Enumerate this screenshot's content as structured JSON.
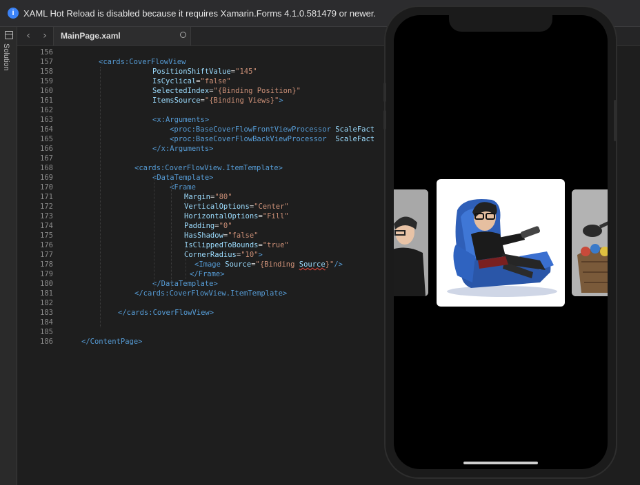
{
  "infobar": {
    "icon": "info-icon",
    "message": "XAML Hot Reload is disabled because it requires Xamarin.Forms 4.1.0.581479 or newer."
  },
  "sidebar": {
    "label": "Solution",
    "icon": "solution-panel-icon"
  },
  "editor": {
    "nav_back": "‹",
    "nav_forward": "›",
    "tab": {
      "label": "MainPage.xaml"
    },
    "lines": [
      {
        "n": "156",
        "indent": 0,
        "parts": []
      },
      {
        "n": "157",
        "indent": 1,
        "parts": [
          {
            "c": "tag",
            "t": "<cards:CoverFlowView"
          }
        ]
      },
      {
        "n": "158",
        "indent": 2,
        "parts": [
          {
            "c": "attr",
            "t": "PositionShiftValue"
          },
          {
            "c": "txt",
            "t": "="
          },
          {
            "c": "str",
            "t": "\"145\""
          }
        ]
      },
      {
        "n": "159",
        "indent": 2,
        "parts": [
          {
            "c": "attr",
            "t": "IsCyclical"
          },
          {
            "c": "txt",
            "t": "="
          },
          {
            "c": "str",
            "t": "\"false\""
          }
        ]
      },
      {
        "n": "160",
        "indent": 2,
        "parts": [
          {
            "c": "attr",
            "t": "SelectedIndex"
          },
          {
            "c": "txt",
            "t": "="
          },
          {
            "c": "str",
            "t": "\"{Binding Position}\""
          }
        ]
      },
      {
        "n": "161",
        "indent": 2,
        "parts": [
          {
            "c": "attr",
            "t": "ItemsSource"
          },
          {
            "c": "txt",
            "t": "="
          },
          {
            "c": "str",
            "t": "\"{Binding Views}\""
          },
          {
            "c": "tag",
            "t": ">"
          }
        ]
      },
      {
        "n": "162",
        "indent": 0,
        "parts": []
      },
      {
        "n": "163",
        "indent": 2,
        "parts": [
          {
            "c": "tag",
            "t": "<x:Arguments>"
          }
        ]
      },
      {
        "n": "164",
        "indent": 3,
        "parts": [
          {
            "c": "tag",
            "t": "<proc:BaseCoverFlowFrontViewProcessor "
          },
          {
            "c": "attr",
            "t": "ScaleFact"
          }
        ]
      },
      {
        "n": "165",
        "indent": 3,
        "parts": [
          {
            "c": "tag",
            "t": "<proc:BaseCoverFlowBackViewProcessor  "
          },
          {
            "c": "attr",
            "t": "ScaleFact"
          }
        ]
      },
      {
        "n": "166",
        "indent": 2,
        "parts": [
          {
            "c": "tag",
            "t": "</x:Arguments>"
          }
        ]
      },
      {
        "n": "167",
        "indent": 0,
        "parts": []
      },
      {
        "n": "168",
        "indent": 4,
        "parts": [
          {
            "c": "tag",
            "t": "<cards:CoverFlowView.ItemTemplate>"
          }
        ]
      },
      {
        "n": "169",
        "indent": 5,
        "parts": [
          {
            "c": "tag",
            "t": "<DataTemplate>"
          }
        ]
      },
      {
        "n": "170",
        "indent": 6,
        "parts": [
          {
            "c": "tag",
            "t": "<Frame"
          }
        ]
      },
      {
        "n": "171",
        "indent": 7,
        "parts": [
          {
            "c": "attr",
            "t": "Margin"
          },
          {
            "c": "txt",
            "t": "="
          },
          {
            "c": "str",
            "t": "\"80\""
          }
        ]
      },
      {
        "n": "172",
        "indent": 7,
        "parts": [
          {
            "c": "attr",
            "t": "VerticalOptions"
          },
          {
            "c": "txt",
            "t": "="
          },
          {
            "c": "str",
            "t": "\"Center\""
          }
        ]
      },
      {
        "n": "173",
        "indent": 7,
        "parts": [
          {
            "c": "attr",
            "t": "HorizontalOptions"
          },
          {
            "c": "txt",
            "t": "="
          },
          {
            "c": "str",
            "t": "\"Fill\""
          }
        ]
      },
      {
        "n": "174",
        "indent": 7,
        "parts": [
          {
            "c": "attr",
            "t": "Padding"
          },
          {
            "c": "txt",
            "t": "="
          },
          {
            "c": "str",
            "t": "\"0\""
          }
        ]
      },
      {
        "n": "175",
        "indent": 7,
        "parts": [
          {
            "c": "attr",
            "t": "HasShadow"
          },
          {
            "c": "txt",
            "t": "="
          },
          {
            "c": "str",
            "t": "\"false\""
          }
        ]
      },
      {
        "n": "176",
        "indent": 7,
        "parts": [
          {
            "c": "attr",
            "t": "IsClippedToBounds"
          },
          {
            "c": "txt",
            "t": "="
          },
          {
            "c": "str",
            "t": "\"true\""
          }
        ]
      },
      {
        "n": "177",
        "indent": 7,
        "parts": [
          {
            "c": "attr",
            "t": "CornerRadius"
          },
          {
            "c": "txt",
            "t": "="
          },
          {
            "c": "str",
            "t": "\"10\""
          },
          {
            "c": "tag",
            "t": ">"
          }
        ]
      },
      {
        "n": "178",
        "indent": 8,
        "parts": [
          {
            "c": "tag",
            "t": "<Image "
          },
          {
            "c": "attr",
            "t": "Source"
          },
          {
            "c": "txt",
            "t": "="
          },
          {
            "c": "str",
            "t": "\"{Binding "
          },
          {
            "c": "attr squig",
            "t": "Source"
          },
          {
            "c": "str",
            "t": "}\""
          },
          {
            "c": "tag",
            "t": "/>"
          }
        ]
      },
      {
        "n": "179",
        "indent": 9,
        "parts": [
          {
            "c": "tag",
            "t": "</Frame>"
          }
        ]
      },
      {
        "n": "180",
        "indent": 5,
        "parts": [
          {
            "c": "tag",
            "t": "</DataTemplate>"
          }
        ]
      },
      {
        "n": "181",
        "indent": 4,
        "parts": [
          {
            "c": "tag",
            "t": "</cards:CoverFlowView.ItemTemplate>"
          }
        ]
      },
      {
        "n": "182",
        "indent": 0,
        "parts": []
      },
      {
        "n": "183",
        "indent": 10,
        "parts": [
          {
            "c": "tag",
            "t": "</cards:CoverFlowView>"
          }
        ]
      },
      {
        "n": "184",
        "indent": 0,
        "parts": []
      },
      {
        "n": "185",
        "indent": 0,
        "parts": []
      },
      {
        "n": "186",
        "indent": 11,
        "parts": [
          {
            "c": "tag",
            "t": "</ContentPage>"
          }
        ]
      }
    ]
  },
  "simulator": {
    "cards": [
      {
        "name": "left-card",
        "image": "bitmoji-partial-image"
      },
      {
        "name": "center-card",
        "image": "bitmoji-recliner-image"
      },
      {
        "name": "right-card",
        "image": "laundry-basket-partial-image"
      }
    ]
  },
  "colors": {
    "tag": "#569cd6",
    "attribute": "#9cdcfe",
    "string": "#ce9178",
    "line_number": "#8a8a8a",
    "background": "#1e1e1e",
    "info": "#3b82f6"
  }
}
